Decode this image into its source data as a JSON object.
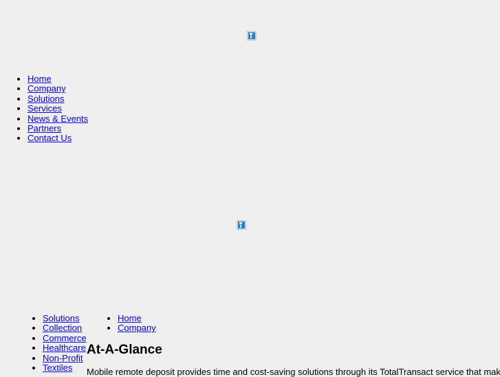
{
  "page": {
    "background_color": "#efefef",
    "link_color": "#0000ee",
    "text_color": "#000000"
  },
  "images": {
    "top_placeholder": {
      "name": "broken-image-placeholder",
      "alt": ""
    },
    "middle_placeholder": {
      "name": "broken-image-placeholder",
      "alt": ""
    }
  },
  "main_nav": {
    "items": [
      {
        "label": "Home"
      },
      {
        "label": "Company"
      },
      {
        "label": "Solutions"
      },
      {
        "label": "Services"
      },
      {
        "label": "News & Events"
      },
      {
        "label": "Partners"
      },
      {
        "label": "Contact Us"
      }
    ]
  },
  "solutions_list": {
    "items": [
      {
        "label": "Solutions"
      },
      {
        "label": "Collection"
      },
      {
        "label": "Commerce"
      },
      {
        "label": "Healthcare"
      },
      {
        "label": "Non-Profit"
      },
      {
        "label": "Textiles"
      }
    ]
  },
  "footer_nav": {
    "items": [
      {
        "label": "Home"
      },
      {
        "label": "Company"
      }
    ]
  },
  "glance": {
    "heading": "At-A-Glance",
    "body": "Mobile remote deposit provides time and cost-saving solutions through its TotalTransact service that make processing"
  }
}
